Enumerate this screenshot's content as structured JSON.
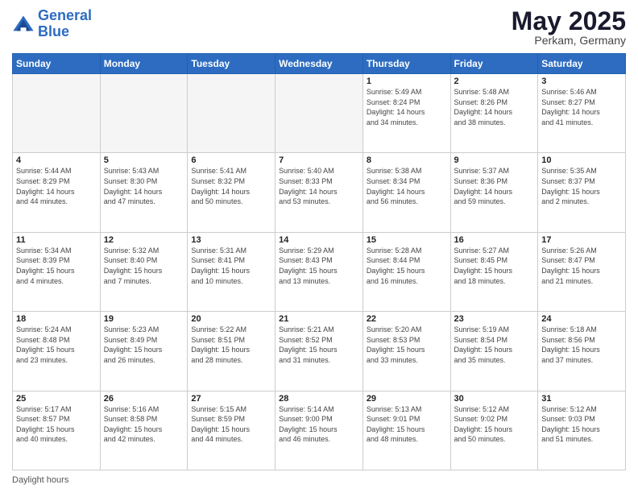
{
  "header": {
    "logo_line1": "General",
    "logo_line2": "Blue",
    "month": "May 2025",
    "location": "Perkam, Germany"
  },
  "days_of_week": [
    "Sunday",
    "Monday",
    "Tuesday",
    "Wednesday",
    "Thursday",
    "Friday",
    "Saturday"
  ],
  "weeks": [
    [
      {
        "num": "",
        "info": ""
      },
      {
        "num": "",
        "info": ""
      },
      {
        "num": "",
        "info": ""
      },
      {
        "num": "",
        "info": ""
      },
      {
        "num": "1",
        "info": "Sunrise: 5:49 AM\nSunset: 8:24 PM\nDaylight: 14 hours\nand 34 minutes."
      },
      {
        "num": "2",
        "info": "Sunrise: 5:48 AM\nSunset: 8:26 PM\nDaylight: 14 hours\nand 38 minutes."
      },
      {
        "num": "3",
        "info": "Sunrise: 5:46 AM\nSunset: 8:27 PM\nDaylight: 14 hours\nand 41 minutes."
      }
    ],
    [
      {
        "num": "4",
        "info": "Sunrise: 5:44 AM\nSunset: 8:29 PM\nDaylight: 14 hours\nand 44 minutes."
      },
      {
        "num": "5",
        "info": "Sunrise: 5:43 AM\nSunset: 8:30 PM\nDaylight: 14 hours\nand 47 minutes."
      },
      {
        "num": "6",
        "info": "Sunrise: 5:41 AM\nSunset: 8:32 PM\nDaylight: 14 hours\nand 50 minutes."
      },
      {
        "num": "7",
        "info": "Sunrise: 5:40 AM\nSunset: 8:33 PM\nDaylight: 14 hours\nand 53 minutes."
      },
      {
        "num": "8",
        "info": "Sunrise: 5:38 AM\nSunset: 8:34 PM\nDaylight: 14 hours\nand 56 minutes."
      },
      {
        "num": "9",
        "info": "Sunrise: 5:37 AM\nSunset: 8:36 PM\nDaylight: 14 hours\nand 59 minutes."
      },
      {
        "num": "10",
        "info": "Sunrise: 5:35 AM\nSunset: 8:37 PM\nDaylight: 15 hours\nand 2 minutes."
      }
    ],
    [
      {
        "num": "11",
        "info": "Sunrise: 5:34 AM\nSunset: 8:39 PM\nDaylight: 15 hours\nand 4 minutes."
      },
      {
        "num": "12",
        "info": "Sunrise: 5:32 AM\nSunset: 8:40 PM\nDaylight: 15 hours\nand 7 minutes."
      },
      {
        "num": "13",
        "info": "Sunrise: 5:31 AM\nSunset: 8:41 PM\nDaylight: 15 hours\nand 10 minutes."
      },
      {
        "num": "14",
        "info": "Sunrise: 5:29 AM\nSunset: 8:43 PM\nDaylight: 15 hours\nand 13 minutes."
      },
      {
        "num": "15",
        "info": "Sunrise: 5:28 AM\nSunset: 8:44 PM\nDaylight: 15 hours\nand 16 minutes."
      },
      {
        "num": "16",
        "info": "Sunrise: 5:27 AM\nSunset: 8:45 PM\nDaylight: 15 hours\nand 18 minutes."
      },
      {
        "num": "17",
        "info": "Sunrise: 5:26 AM\nSunset: 8:47 PM\nDaylight: 15 hours\nand 21 minutes."
      }
    ],
    [
      {
        "num": "18",
        "info": "Sunrise: 5:24 AM\nSunset: 8:48 PM\nDaylight: 15 hours\nand 23 minutes."
      },
      {
        "num": "19",
        "info": "Sunrise: 5:23 AM\nSunset: 8:49 PM\nDaylight: 15 hours\nand 26 minutes."
      },
      {
        "num": "20",
        "info": "Sunrise: 5:22 AM\nSunset: 8:51 PM\nDaylight: 15 hours\nand 28 minutes."
      },
      {
        "num": "21",
        "info": "Sunrise: 5:21 AM\nSunset: 8:52 PM\nDaylight: 15 hours\nand 31 minutes."
      },
      {
        "num": "22",
        "info": "Sunrise: 5:20 AM\nSunset: 8:53 PM\nDaylight: 15 hours\nand 33 minutes."
      },
      {
        "num": "23",
        "info": "Sunrise: 5:19 AM\nSunset: 8:54 PM\nDaylight: 15 hours\nand 35 minutes."
      },
      {
        "num": "24",
        "info": "Sunrise: 5:18 AM\nSunset: 8:56 PM\nDaylight: 15 hours\nand 37 minutes."
      }
    ],
    [
      {
        "num": "25",
        "info": "Sunrise: 5:17 AM\nSunset: 8:57 PM\nDaylight: 15 hours\nand 40 minutes."
      },
      {
        "num": "26",
        "info": "Sunrise: 5:16 AM\nSunset: 8:58 PM\nDaylight: 15 hours\nand 42 minutes."
      },
      {
        "num": "27",
        "info": "Sunrise: 5:15 AM\nSunset: 8:59 PM\nDaylight: 15 hours\nand 44 minutes."
      },
      {
        "num": "28",
        "info": "Sunrise: 5:14 AM\nSunset: 9:00 PM\nDaylight: 15 hours\nand 46 minutes."
      },
      {
        "num": "29",
        "info": "Sunrise: 5:13 AM\nSunset: 9:01 PM\nDaylight: 15 hours\nand 48 minutes."
      },
      {
        "num": "30",
        "info": "Sunrise: 5:12 AM\nSunset: 9:02 PM\nDaylight: 15 hours\nand 50 minutes."
      },
      {
        "num": "31",
        "info": "Sunrise: 5:12 AM\nSunset: 9:03 PM\nDaylight: 15 hours\nand 51 minutes."
      }
    ]
  ],
  "footer": {
    "daylight_label": "Daylight hours"
  }
}
